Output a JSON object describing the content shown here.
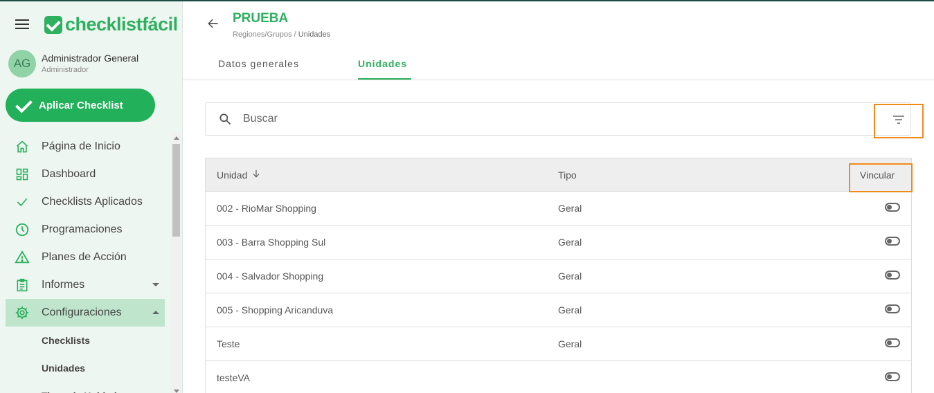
{
  "app": {
    "logo_text": "checklistfácil",
    "brand_color": "#2eb05e",
    "highlight_color": "#f28a1a"
  },
  "user": {
    "initials": "AG",
    "name": "Administrador General",
    "role": "Administrador"
  },
  "apply_button": {
    "label": "Aplicar Checklist"
  },
  "nav": {
    "items": [
      {
        "label": "Página de Inicio",
        "icon": "home-icon"
      },
      {
        "label": "Dashboard",
        "icon": "dashboard-icon"
      },
      {
        "label": "Checklists Aplicados",
        "icon": "check-icon"
      },
      {
        "label": "Programaciones",
        "icon": "clock-icon"
      },
      {
        "label": "Planes de Acción",
        "icon": "warning-icon"
      },
      {
        "label": "Informes",
        "icon": "clipboard-icon"
      },
      {
        "label": "Configuraciones",
        "icon": "gear-icon"
      }
    ],
    "sub_items": [
      {
        "label": "Checklists"
      },
      {
        "label": "Unidades"
      },
      {
        "label": "Tipos de Unidad"
      }
    ]
  },
  "header": {
    "title": "PRUEBA",
    "breadcrumb_parent": "Regiones/Grupos /",
    "breadcrumb_current": "Unidades"
  },
  "tabs": [
    {
      "label": "Datos generales"
    },
    {
      "label": "Unidades"
    }
  ],
  "search": {
    "placeholder": "Buscar"
  },
  "table": {
    "columns": {
      "unidad": "Unidad",
      "tipo": "Tipo",
      "vincular": "Vincular"
    },
    "rows": [
      {
        "unidad": "002 - RioMar Shopping",
        "tipo": "Geral"
      },
      {
        "unidad": "003 - Barra Shopping Sul",
        "tipo": "Geral"
      },
      {
        "unidad": "004 - Salvador Shopping",
        "tipo": "Geral"
      },
      {
        "unidad": "005 - Shopping Aricanduva",
        "tipo": "Geral"
      },
      {
        "unidad": "Teste",
        "tipo": "Geral"
      },
      {
        "unidad": "testeVA",
        "tipo": ""
      }
    ]
  }
}
